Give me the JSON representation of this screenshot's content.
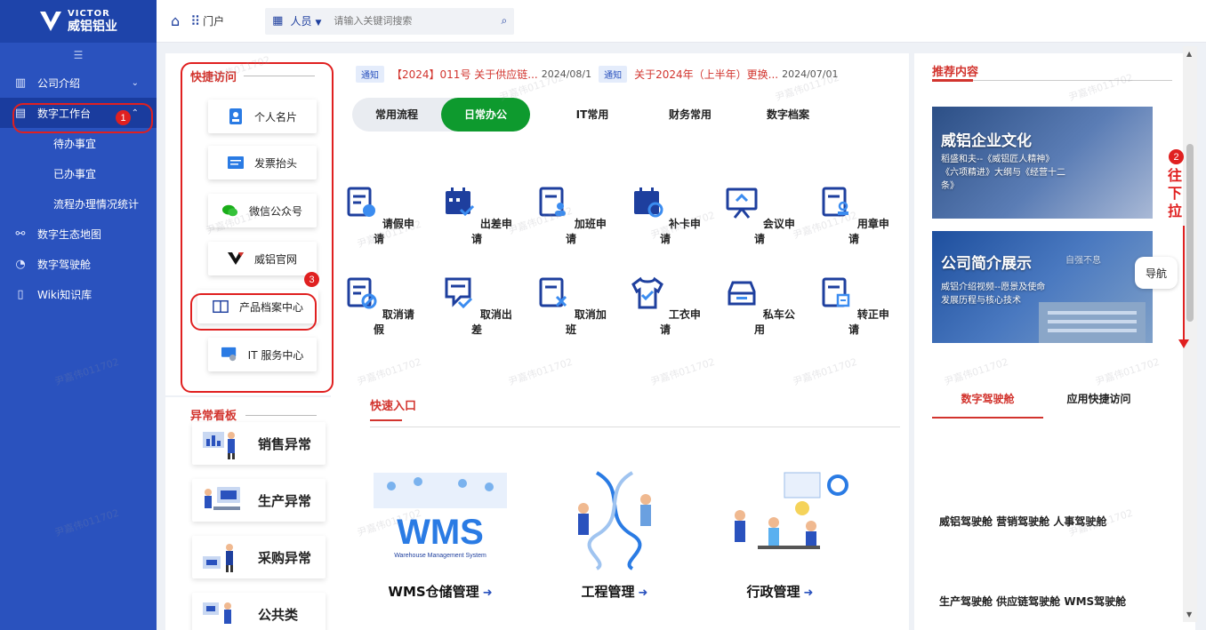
{
  "app": {
    "brand_en": "VICTOR",
    "brand_cn": "威铝铝业"
  },
  "sidebar": {
    "items": [
      {
        "label": "公司介绍",
        "icon": "building-icon",
        "has_arrow": true
      },
      {
        "label": "数字工作台",
        "icon": "workbench-icon",
        "has_arrow": true,
        "active": true
      },
      {
        "label": "数字生态地图",
        "icon": "network-icon"
      },
      {
        "label": "数字驾驶舱",
        "icon": "dashboard-icon"
      },
      {
        "label": "Wiki知识库",
        "icon": "book-icon"
      }
    ],
    "subitems": [
      "待办事宜",
      "已办事宜",
      "流程办理情况统计"
    ]
  },
  "topbar": {
    "portal": "门户",
    "search_scope": "人员",
    "search_placeholder": "请输入关键词搜索"
  },
  "quick_access": {
    "title": "快捷访问",
    "buttons": [
      "个人名片",
      "发票抬头",
      "微信公众号",
      "威铝官网",
      "产品档案中心",
      "IT 服务中心"
    ]
  },
  "abnormal_board": {
    "title": "异常看板",
    "items": [
      "销售异常",
      "生产异常",
      "采购异常",
      "公共类"
    ]
  },
  "notices": [
    {
      "tag": "通知",
      "text": "【2024】011号 关于供应链...",
      "date": "2024/08/1"
    },
    {
      "tag": "通知",
      "text": "关于2024年（上半年）更换...",
      "date": "2024/07/01"
    }
  ],
  "tabs": [
    "常用流程",
    "日常办公",
    "IT常用",
    "财务常用",
    "数字档案"
  ],
  "active_tab": "日常办公",
  "functions": [
    "请假申请",
    "出差申请",
    "加班申请",
    "补卡申请",
    "会议申请",
    "用章申请",
    "取消请假",
    "取消出差",
    "取消加班",
    "工衣申请",
    "私车公用",
    "转正申请"
  ],
  "fast_entry": {
    "title": "快速入口",
    "items": [
      "WMS仓储管理",
      "工程管理",
      "行政管理"
    ],
    "wms_logo": "WMS",
    "wms_sub": "Warehouse Management System"
  },
  "recommend": {
    "title": "推荐内容",
    "banner1": {
      "title": "威铝企业文化",
      "lines": [
        "稻盛和夫--《威铝匠人精神》",
        "《六项精进》大纲与《经营十二",
        "条》"
      ]
    },
    "banner2": {
      "title": "公司简介展示",
      "tag": "自强不息",
      "lines": [
        "威铝介绍视频--愿景及使命",
        "发展历程与核心技术"
      ]
    }
  },
  "cockpit_tabs": [
    "数字驾驶舱",
    "应用快捷访问"
  ],
  "cockpit_rows": [
    "威铝驾驶舱  营销驾驶舱  人事驾驶舱",
    "生产驾驶舱  供应链驾驶舱 WMS驾驶舱"
  ],
  "nav_button": "导航",
  "annotations": {
    "badge1": "1",
    "badge2": "2",
    "badge3": "3",
    "scroll_hint": [
      "往",
      "下",
      "拉"
    ]
  },
  "watermark": "尹嘉伟011702",
  "colors": {
    "sidebar": "#2a52be",
    "accent_red": "#d2342e",
    "active_green": "#0e9a2e",
    "annotation": "#e02020"
  }
}
